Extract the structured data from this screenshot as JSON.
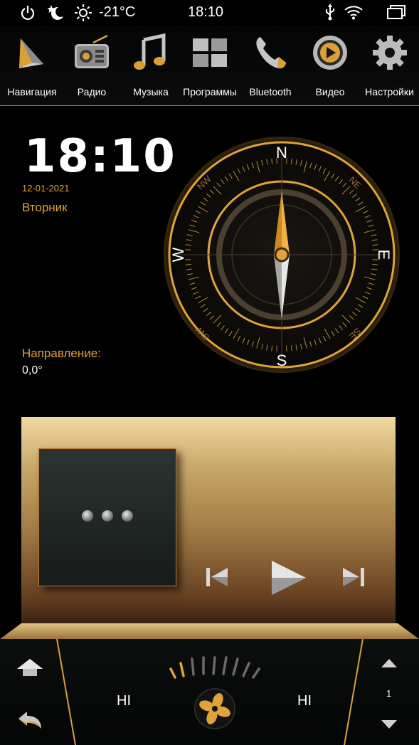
{
  "colors": {
    "accent": "#e0a23a",
    "gold": "#d8a040",
    "dark": "#000000"
  },
  "statusbar": {
    "power_icon": "power-icon",
    "night_icon": "moon-star-icon",
    "weather_icon": "sun-icon",
    "temperature": "-21°C",
    "time": "18:10",
    "usb_icon": "usb-icon",
    "wifi_icon": "wifi-icon",
    "recents_icon": "recent-apps-icon"
  },
  "dock": {
    "items": [
      {
        "label": "Навигация",
        "icon": "navigation-arrow-icon"
      },
      {
        "label": "Радио",
        "icon": "radio-icon"
      },
      {
        "label": "Музыка",
        "icon": "music-note-icon"
      },
      {
        "label": "Программы",
        "icon": "apps-grid-icon"
      },
      {
        "label": "Bluetooth",
        "icon": "phone-icon"
      },
      {
        "label": "Видео",
        "icon": "play-disc-icon"
      },
      {
        "label": "Настройки",
        "icon": "gear-icon"
      }
    ]
  },
  "clock": {
    "time": "18:10",
    "date": "12-01-2021",
    "day": "Вторник"
  },
  "compass": {
    "direction_label": "Направление:",
    "direction_value": "0,0°",
    "heading_deg": 0,
    "cardinals": {
      "n": "N",
      "e": "E",
      "s": "S",
      "w": "W"
    },
    "intercardinals": {
      "ne": "NE",
      "se": "SE",
      "sw": "SW",
      "nw": "NW"
    }
  },
  "media": {
    "album_placeholder_icon": "ellipsis-icon",
    "prev_icon": "skip-previous-icon",
    "play_icon": "play-icon",
    "next_icon": "skip-next-icon"
  },
  "climate": {
    "left_level": "HI",
    "right_level": "HI",
    "fan_speed": "1",
    "home_icon": "home-arrow-icon",
    "back_icon": "back-arrow-icon",
    "fan_icon": "fan-icon",
    "up_icon": "chevron-up-icon",
    "down_icon": "chevron-down-icon"
  }
}
